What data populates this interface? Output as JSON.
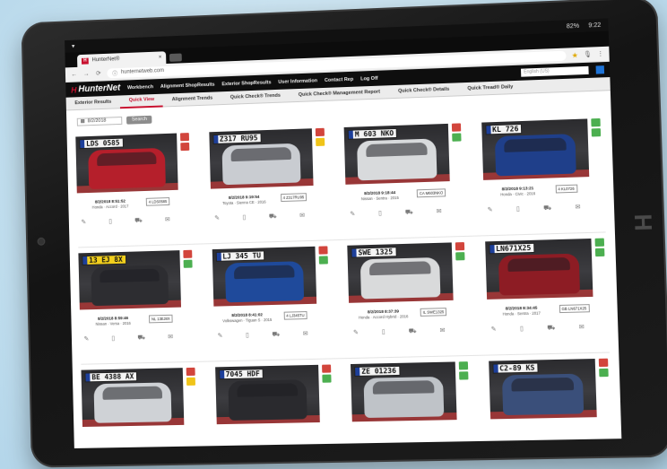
{
  "device": {
    "status_bar": {
      "battery": "82%",
      "time": "9:22"
    }
  },
  "browser": {
    "tab_title": "HunterNet®",
    "url": "hunternetweb.com",
    "back": "←",
    "forward": "→",
    "reload": "⟳"
  },
  "app": {
    "brand": "HunterNet",
    "brand_mark": "H",
    "nav": [
      "Workbench",
      "Alignment ShopResults",
      "Exterior ShopResults",
      "User Information",
      "Contact Rep",
      "Log Off"
    ],
    "search_placeholder": "English (US)",
    "subnav": [
      {
        "label": "Exterior Results",
        "active": false
      },
      {
        "label": "Quick View",
        "active": true
      },
      {
        "label": "Alignment Trends",
        "active": false
      },
      {
        "label": "Quick Check® Trends",
        "active": false
      },
      {
        "label": "Quick Check® Management Report",
        "active": false
      },
      {
        "label": "Quick Check® Details",
        "active": false
      },
      {
        "label": "Quick Tread® Daily",
        "active": false
      }
    ],
    "filter": {
      "date": "8/2/2018",
      "search_label": "Search"
    }
  },
  "rows": [
    [
      {
        "plate": "LDS 0585",
        "plate_style": "white",
        "car_color": "#b51f2b",
        "dt": "8/2/2018 8:51:52",
        "vehicle": "Honda · Accord · 2017",
        "code": "4 LDS0585",
        "badges": [
          "#d2453c",
          "#d2453c"
        ]
      },
      {
        "plate": "Z317 RU95",
        "plate_style": "white",
        "car_color": "#c9ccd1",
        "dt": "8/2/2018 9:19:54",
        "vehicle": "Toyota · Sienna CE · 2016",
        "code": "4 Z317RU95",
        "badges": [
          "#d2453c",
          "#f0c419"
        ]
      },
      {
        "plate": "M 603 NKO",
        "plate_style": "white",
        "car_color": "#d8dadc",
        "dt": "8/2/2018 9:18:44",
        "vehicle": "Nissan · Sentra · 2015",
        "code": "CA M603NKO",
        "badges": [
          "#d2453c",
          "#4caf50"
        ]
      },
      {
        "plate": "KL 726",
        "plate_style": "white",
        "car_color": "#1f3f8a",
        "dt": "8/2/2018 9:13:21",
        "vehicle": "Honda · Civic · 2016",
        "code": "4 KL0726",
        "badges": [
          "#4caf50",
          "#4caf50"
        ]
      }
    ],
    [
      {
        "plate": "13 EJ 8X",
        "plate_style": "yellow",
        "car_color": "#2d2d31",
        "dt": "8/2/2018 8:59:46",
        "vehicle": "Nissan · Versa · 2016",
        "code": "NL 13EJ8X",
        "badges": [
          "#d2453c",
          "#4caf50"
        ]
      },
      {
        "plate": "LJ 345 TU",
        "plate_style": "white",
        "car_color": "#1f4a9b",
        "dt": "8/2/2018 8:41:02",
        "vehicle": "Volkswagen · Tiguan S · 2015",
        "code": "4 LJ345TU",
        "badges": [
          "#d2453c",
          "#4caf50"
        ]
      },
      {
        "plate": "SWE 1325",
        "plate_style": "white",
        "car_color": "#d9dadb",
        "dt": "8/2/2018 8:37:39",
        "vehicle": "Honda · Accord Hybrid · 2016",
        "code": "IL SWE1325",
        "badges": [
          "#d2453c",
          "#4caf50"
        ]
      },
      {
        "plate": "LN671X25",
        "plate_style": "white",
        "car_color": "#8d1c24",
        "dt": "8/2/2018 8:34:45",
        "vehicle": "Honda · Sentra · 2017",
        "code": "GB LN671X25",
        "badges": [
          "#4caf50",
          "#4caf50"
        ]
      }
    ],
    [
      {
        "plate": "BE 4388 AX",
        "plate_style": "white",
        "car_color": "#cfd2d6",
        "dt": "",
        "vehicle": "",
        "code": "",
        "badges": [
          "#d2453c",
          "#f0c419"
        ]
      },
      {
        "plate": "7045 HDF",
        "plate_style": "white",
        "car_color": "#2a2a2e",
        "dt": "",
        "vehicle": "",
        "code": "",
        "badges": [
          "#d2453c",
          "#4caf50"
        ]
      },
      {
        "plate": "ZE 01236",
        "plate_style": "white",
        "car_color": "#bfc3c8",
        "dt": "",
        "vehicle": "",
        "code": "",
        "badges": [
          "#4caf50",
          "#4caf50"
        ]
      },
      {
        "plate": "C2-89 KS",
        "plate_style": "white",
        "car_color": "#3a4f7a",
        "dt": "",
        "vehicle": "",
        "code": "",
        "badges": [
          "#d2453c",
          "#4caf50"
        ]
      }
    ]
  ],
  "card_actions": [
    "pencil-icon",
    "document-icon",
    "car-icon",
    "email-icon"
  ]
}
